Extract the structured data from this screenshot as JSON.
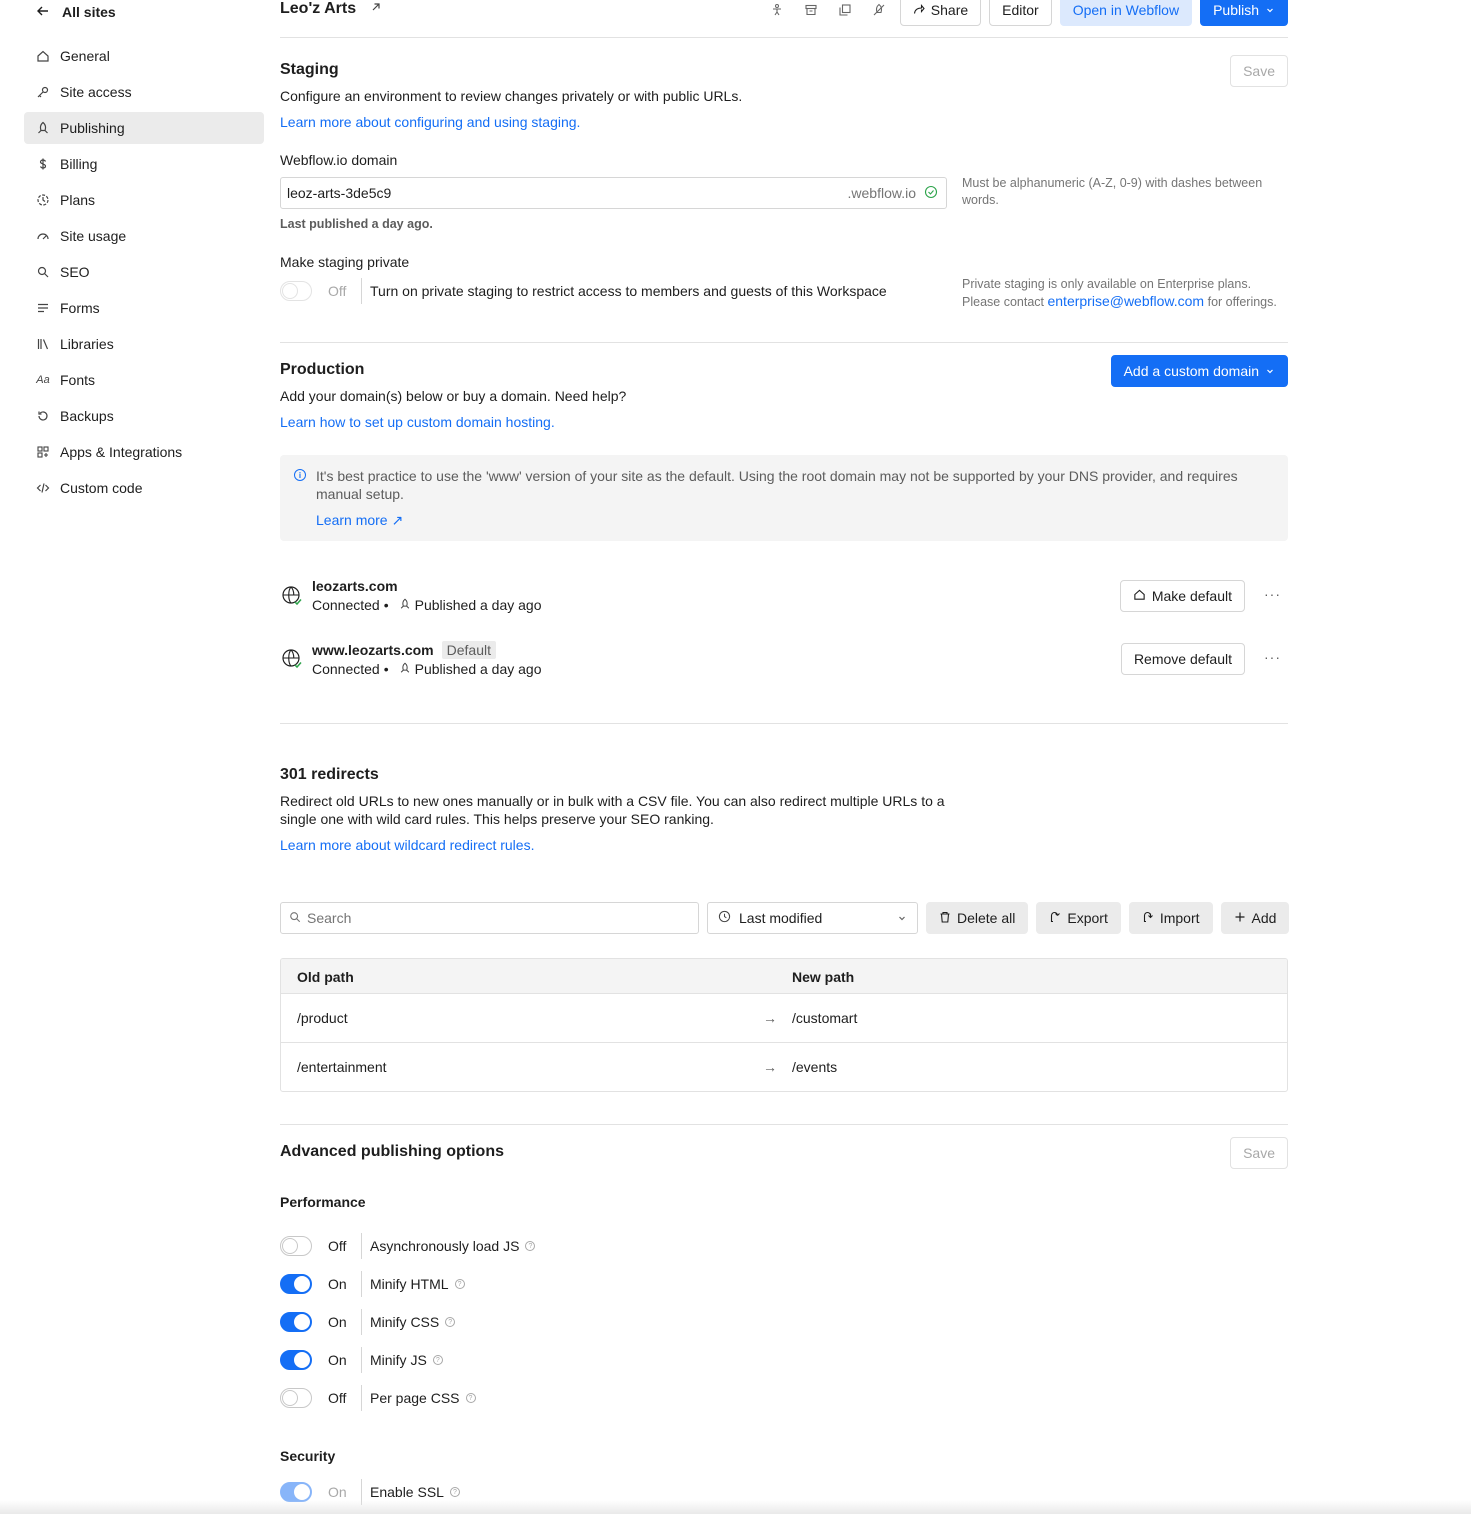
{
  "sidebar": {
    "back_label": "All sites",
    "items": [
      {
        "label": "General",
        "icon": "home-icon"
      },
      {
        "label": "Site access",
        "icon": "key-icon"
      },
      {
        "label": "Publishing",
        "icon": "rocket-icon",
        "active": true
      },
      {
        "label": "Billing",
        "icon": "dollar-icon"
      },
      {
        "label": "Plans",
        "icon": "plans-icon"
      },
      {
        "label": "Site usage",
        "icon": "gauge-icon"
      },
      {
        "label": "SEO",
        "icon": "search-icon"
      },
      {
        "label": "Forms",
        "icon": "forms-icon"
      },
      {
        "label": "Libraries",
        "icon": "libraries-icon"
      },
      {
        "label": "Fonts",
        "icon": "fonts-icon"
      },
      {
        "label": "Backups",
        "icon": "backup-icon"
      },
      {
        "label": "Apps & Integrations",
        "icon": "apps-icon"
      },
      {
        "label": "Custom code",
        "icon": "code-icon"
      }
    ]
  },
  "header": {
    "site_name": "Leo'z Arts",
    "share_label": "Share",
    "editor_label": "Editor",
    "open_label": "Open in Webflow",
    "publish_label": "Publish"
  },
  "staging": {
    "title": "Staging",
    "save_label": "Save",
    "description": "Configure an environment to review changes privately or with public URLs.",
    "learn_link": "Learn more about configuring and using staging.",
    "domain_label": "Webflow.io domain",
    "domain_value": "leoz-arts-3de5c9",
    "domain_suffix": ".webflow.io",
    "domain_hint": "Must be alphanumeric (A-Z, 0-9) with dashes between words.",
    "last_published": "Last published a day ago.",
    "private_label": "Make staging private",
    "private_state": "Off",
    "private_desc": "Turn on private staging to restrict access to members and guests of this Workspace",
    "enterprise_note_1": "Private staging is only available on Enterprise plans.",
    "enterprise_note_2": "Please contact",
    "enterprise_email": "enterprise@webflow.com",
    "enterprise_note_3": "for offerings."
  },
  "production": {
    "title": "Production",
    "add_domain_label": "Add a custom domain",
    "description": "Add your domain(s) below or buy a domain. Need help?",
    "learn_link": "Learn how to set up custom domain hosting.",
    "callout_text": "It's best practice to use the 'www' version of your site as the default. Using the root domain may not be supported by your DNS provider, and requires manual setup.",
    "callout_link": "Learn more",
    "domains": [
      {
        "name": "leozarts.com",
        "status": "Connected",
        "published": "Published a day ago",
        "action": "Make default",
        "badge": ""
      },
      {
        "name": "www.leozarts.com",
        "status": "Connected",
        "published": "Published a day ago",
        "action": "Remove default",
        "badge": "Default"
      }
    ]
  },
  "redirects": {
    "title": "301 redirects",
    "description_1": "Redirect old URLs to new ones manually or in bulk with a CSV file. You can also redirect multiple URLs to a",
    "description_2": "single one with wild card rules. This helps preserve your SEO ranking.",
    "learn_link": "Learn more about wildcard redirect rules.",
    "search_placeholder": "Search",
    "sort_value": "Last modified",
    "delete_all_label": "Delete all",
    "export_label": "Export",
    "import_label": "Import",
    "add_label": "Add",
    "col_old": "Old path",
    "col_new": "New path",
    "rows": [
      {
        "old": "/product",
        "new": "/customart"
      },
      {
        "old": "/entertainment",
        "new": "/events"
      }
    ]
  },
  "advanced": {
    "title": "Advanced publishing options",
    "save_label": "Save",
    "performance_title": "Performance",
    "options": [
      {
        "state": "Off",
        "label": "Asynchronously load JS"
      },
      {
        "state": "On",
        "label": "Minify HTML"
      },
      {
        "state": "On",
        "label": "Minify CSS"
      },
      {
        "state": "On",
        "label": "Minify JS"
      },
      {
        "state": "Off",
        "label": "Per page CSS"
      }
    ],
    "security_title": "Security",
    "ssl": {
      "state": "On",
      "label": "Enable SSL"
    }
  },
  "colors": {
    "accent": "#146ef5",
    "active_nav": "#ebebeb",
    "success": "#2ca34a"
  }
}
